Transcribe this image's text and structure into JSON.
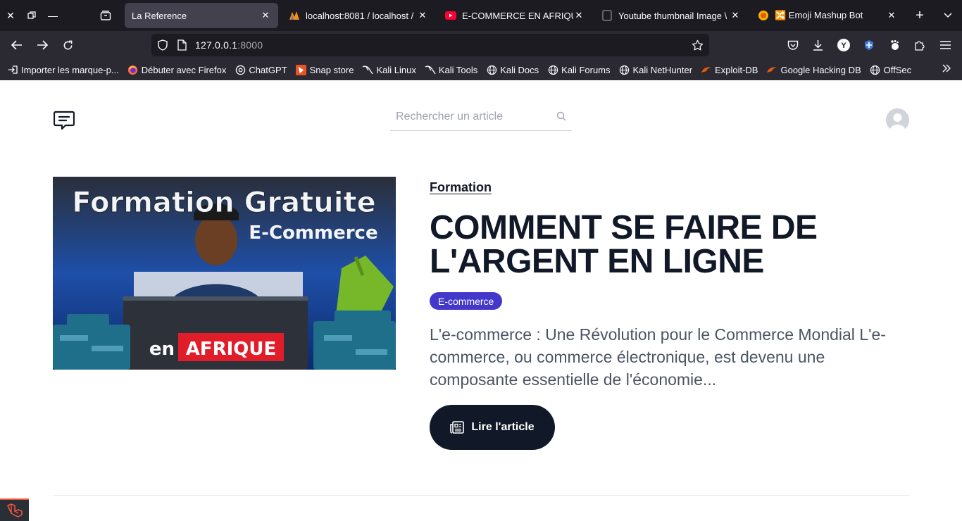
{
  "browser": {
    "tabs": [
      {
        "title": "La Reference",
        "icon": "none",
        "active": true
      },
      {
        "title": "localhost:8081 / localhost / ",
        "icon": "phpmyadmin-icon",
        "active": false
      },
      {
        "title": "E-COMMERCE EN AFRIQUE",
        "icon": "youtube-icon",
        "active": false
      },
      {
        "title": "Youtube thumbnail Image \\",
        "icon": "page-icon",
        "active": false
      },
      {
        "title": "🔀 Emoji Mashup Bot",
        "icon": "emoji-icon",
        "active": false
      }
    ],
    "url_host": "127.0.0.1",
    "url_port": ":8000",
    "bookmarks": [
      {
        "label": "Importer les marque-p...",
        "icon": "import-icon"
      },
      {
        "label": "Débuter avec Firefox",
        "icon": "firefox-icon"
      },
      {
        "label": "ChatGPT",
        "icon": "chatgpt-icon"
      },
      {
        "label": "Snap store",
        "icon": "snap-icon"
      },
      {
        "label": "Kali Linux",
        "icon": "kali-icon"
      },
      {
        "label": "Kali Tools",
        "icon": "kali-icon"
      },
      {
        "label": "Kali Docs",
        "icon": "globe-icon"
      },
      {
        "label": "Kali Forums",
        "icon": "globe-icon"
      },
      {
        "label": "Kali NetHunter",
        "icon": "globe-icon"
      },
      {
        "label": "Exploit-DB",
        "icon": "exploitdb-icon"
      },
      {
        "label": "Google Hacking DB",
        "icon": "exploitdb-icon"
      },
      {
        "label": "OffSec",
        "icon": "globe-icon"
      }
    ]
  },
  "header": {
    "search_placeholder": "Rechercher un article"
  },
  "article": {
    "thumbnail": {
      "line1": "Formation Gratuite",
      "line2": "E-Commerce",
      "line3_prefix": "en",
      "line3_highlight": "AFRIQUE"
    },
    "category": "Formation",
    "title": "COMMENT SE FAIRE DE L'ARGENT EN LIGNE",
    "tag": "E-commerce",
    "excerpt": "L'e-commerce : Une Révolution pour le Commerce Mondial L'e-commerce, ou commerce électronique, est devenu une composante essentielle de l'économie...",
    "read_button": "Lire l'article"
  },
  "colors": {
    "tag_bg": "#4338ca",
    "button_bg": "#111827",
    "laravel_red": "#f05340"
  }
}
